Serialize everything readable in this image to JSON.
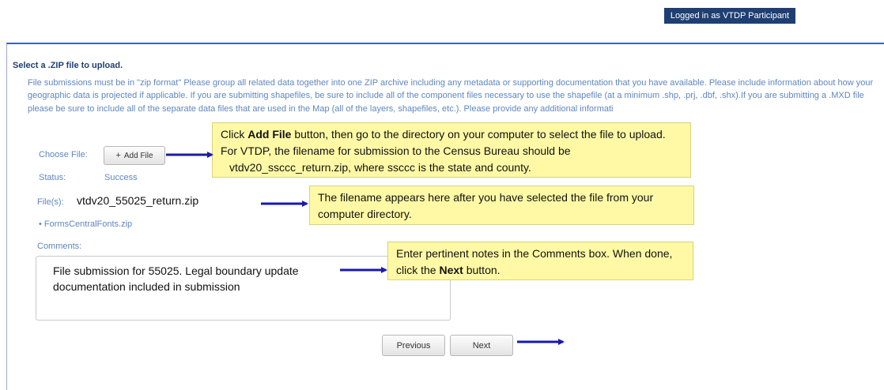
{
  "header": {
    "login_status": "Logged in as VTDP Participant"
  },
  "form": {
    "heading": "Select a .ZIP file to upload.",
    "description": "File submissions must be in \"zip format\" Please group all related data together into one ZIP archive including any metadata or supporting documentation that you have available. Please include information about how your geographic data is projected if applicable. If you are submitting shapefiles, be sure to include all of the component files necessary to use the shapefile (at a minimum .shp, .prj, .dbf, .shx).If you are submitting a .MXD file please be sure to include all of the separate data files that are used in the Map (all of the layers, shapefiles, etc.). Please provide any additional informati",
    "choose_file_label": "Choose File:",
    "add_file_icon": "plus-icon",
    "add_file_label": "Add File",
    "status_label": "Status:",
    "status_value": "Success",
    "files_label": "File(s):",
    "filename": "vtdv20_55025_return.zip",
    "uploaded_files": [
      "FormsCentralFonts.zip"
    ],
    "comments_label": "Comments:",
    "comments_value": "File submission for 55025. Legal boundary update documentation included in submission",
    "previous_label": "Previous",
    "next_label": "Next"
  },
  "callouts": {
    "add_file": {
      "pre": "Click ",
      "bold": "Add File",
      "post": " button, then go to the directory on your computer to select the file to upload. For VTDP, the filename for submission to the Census Bureau should be",
      "line3": "vtdv20_ssccc_return.zip, where ssccc is the state and county."
    },
    "filename": "The filename appears here after you have selected the file from your computer directory.",
    "comments": {
      "pre": "Enter pertinent notes in the Comments box. When done, click the ",
      "bold": "Next",
      "post": " button."
    }
  },
  "colors": {
    "badge": "#1f3f73",
    "callout_fill": "#fff9a6",
    "arrow": "#1a1aa8",
    "label_text": "#5f86bf"
  }
}
